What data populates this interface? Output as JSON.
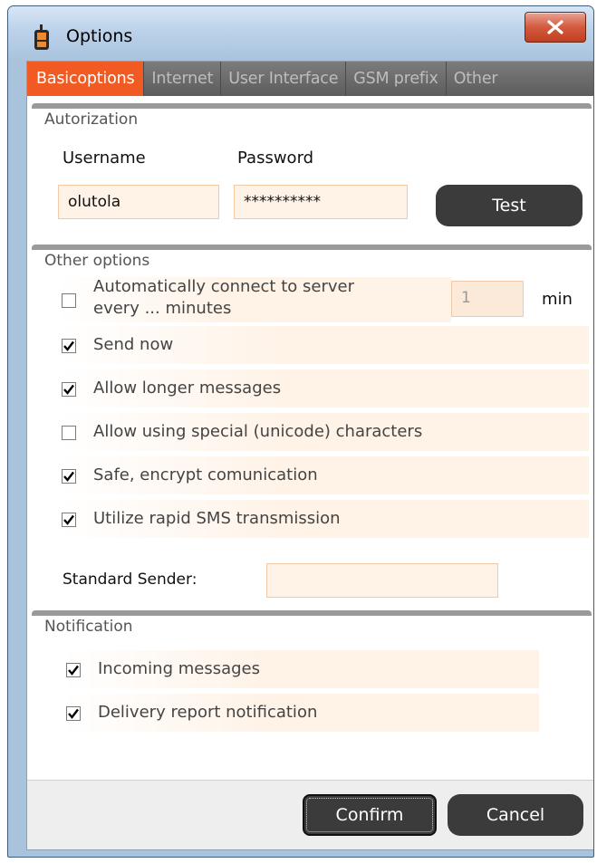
{
  "window": {
    "title": "Options"
  },
  "tabs": [
    {
      "label": "Basicoptions",
      "active": true
    },
    {
      "label": "Internet",
      "active": false
    },
    {
      "label": "User Interface",
      "active": false
    },
    {
      "label": "GSM prefix",
      "active": false
    },
    {
      "label": "Other",
      "active": false
    }
  ],
  "authorization": {
    "title": "Autorization",
    "username_label": "Username",
    "password_label": "Password",
    "username_value": "olutola",
    "password_value": "**********",
    "test_label": "Test"
  },
  "other_options": {
    "title": "Other options",
    "auto_connect": {
      "line1": "Automatically connect to server",
      "line2": "every ... minutes",
      "checked": false,
      "minutes": "1",
      "unit": "min"
    },
    "options": [
      {
        "label": "Send now",
        "checked": true
      },
      {
        "label": "Allow longer messages",
        "checked": true
      },
      {
        "label": "Allow using special (unicode) characters",
        "checked": false
      },
      {
        "label": "Safe, encrypt comunication",
        "checked": true
      },
      {
        "label": "Utilize rapid SMS transmission",
        "checked": true
      }
    ],
    "standard_sender_label": "Standard Sender:",
    "standard_sender_value": ""
  },
  "notification": {
    "title": "Notification",
    "options": [
      {
        "label": "Incoming messages",
        "checked": true
      },
      {
        "label": "Delivery report notification",
        "checked": true
      }
    ]
  },
  "footer": {
    "confirm_label": "Confirm",
    "cancel_label": "Cancel"
  },
  "colors": {
    "accent": "#f15a22",
    "tabbar": "#6b6b6b",
    "button": "#3b3b3b",
    "field": "#fff2e6"
  }
}
